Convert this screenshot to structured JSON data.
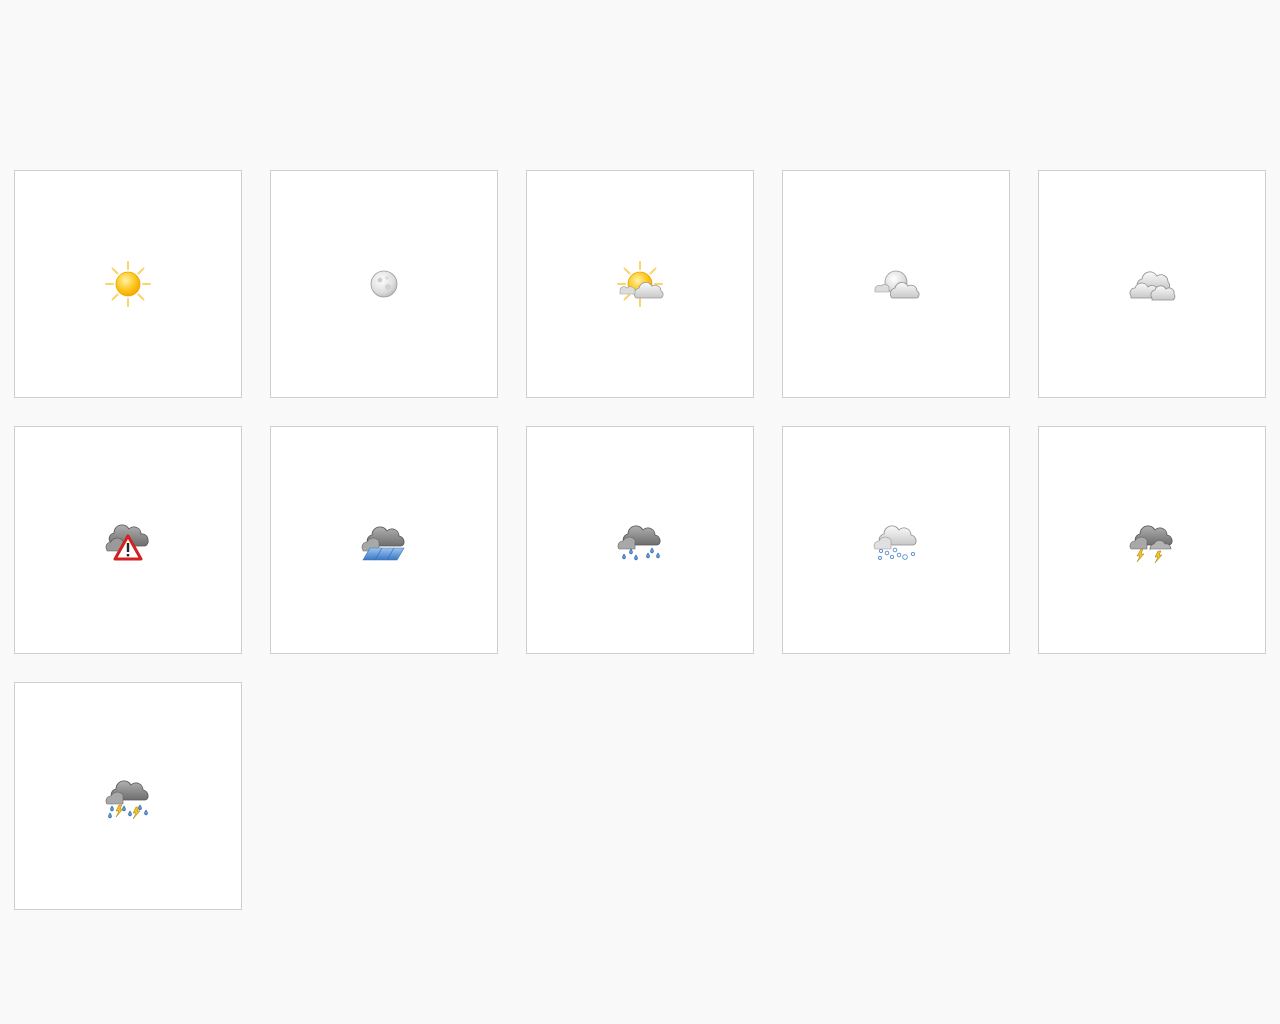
{
  "tiles": [
    {
      "icon": "weather-clear-icon"
    },
    {
      "icon": "weather-clear-night-icon"
    },
    {
      "icon": "weather-few-clouds-icon"
    },
    {
      "icon": "weather-few-clouds-night-icon"
    },
    {
      "icon": "weather-overcast-icon"
    },
    {
      "icon": "weather-severe-alert-icon"
    },
    {
      "icon": "weather-showers-icon"
    },
    {
      "icon": "weather-showers-scattered-icon"
    },
    {
      "icon": "weather-snow-icon"
    },
    {
      "icon": "weather-storm-icon"
    },
    {
      "icon": "weather-storm-showers-icon"
    }
  ],
  "colors": {
    "page_background": "#f9f9f9",
    "tile_background": "#ffffff",
    "tile_border": "#cfcfcf",
    "sun": "#fcc419",
    "sun_ray": "#fde68a",
    "moon": "#e2e2e2",
    "cloud_light": "#e6e6e6",
    "cloud_dark": "#8a8a8a",
    "rain": "#4a8ad8",
    "lightning": "#f2c12e",
    "alert_red": "#d42020"
  }
}
